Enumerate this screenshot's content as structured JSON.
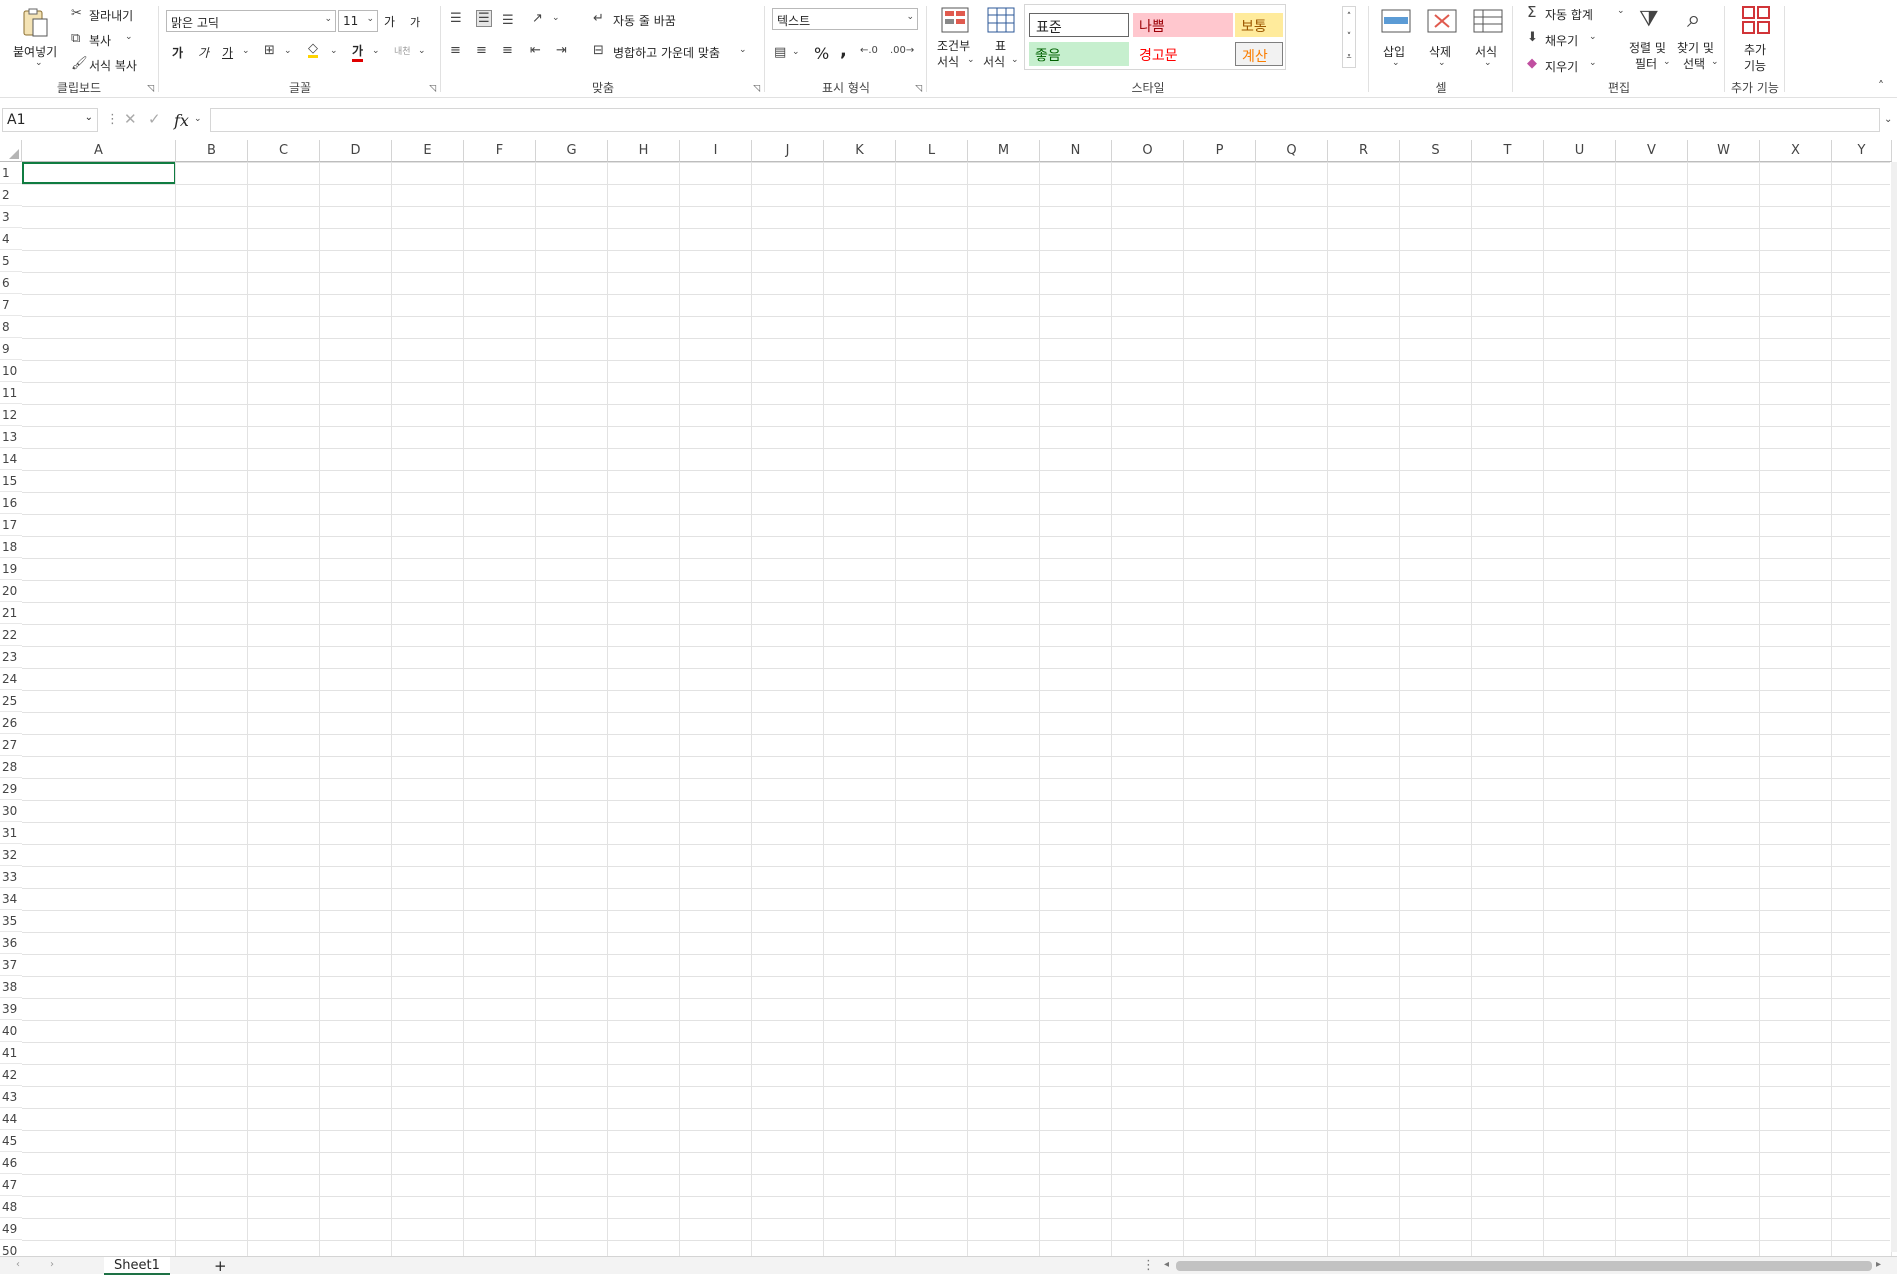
{
  "ribbon": {
    "clipboard": {
      "paste_label": "붙여넣기",
      "cut_label": "잘라내기",
      "copy_label": "복사",
      "format_painter_label": "서식 복사",
      "group_label": "클립보드"
    },
    "font": {
      "font_name": "맑은 고딕",
      "font_size": "11",
      "grow_label": "가",
      "shrink_label": "가",
      "bold_label": "가",
      "italic_label": "가",
      "underline_label": "가",
      "font_color_label": "가",
      "phonetic_label": "내천",
      "group_label": "글꼴"
    },
    "alignment": {
      "wrap_text_label": "자동 줄 바꿈",
      "merge_center_label": "병합하고 가운데 맞춤",
      "group_label": "맞춤"
    },
    "number": {
      "format_value": "텍스트",
      "percent_label": "%",
      "comma_label": ",",
      "group_label": "표시 형식"
    },
    "styles": {
      "conditional_format_label": "조건부",
      "conditional_format_label2": "서식",
      "table_format_label": "표",
      "table_format_label2": "서식",
      "cells": [
        {
          "label": "표준",
          "bg": "#ffffff",
          "fg": "#000000"
        },
        {
          "label": "나쁨",
          "bg": "#ffc7ce",
          "fg": "#9c0006"
        },
        {
          "label": "보통",
          "bg": "#ffeb9c",
          "fg": "#9c5700"
        },
        {
          "label": "좋음",
          "bg": "#c6efce",
          "fg": "#006100"
        },
        {
          "label": "경고문",
          "bg": "#ffffff",
          "fg": "#ff0000"
        },
        {
          "label": "계산",
          "bg": "#f2f2f2",
          "fg": "#fa7d00"
        }
      ],
      "group_label": "스타일"
    },
    "cells": {
      "insert_label": "삽입",
      "delete_label": "삭제",
      "format_label": "서식",
      "group_label": "셀"
    },
    "editing": {
      "autosum_label": "자동 합계",
      "fill_label": "채우기",
      "clear_label": "지우기",
      "sort_filter_label": "정렬 및",
      "sort_filter_label2": "필터",
      "find_select_label": "찾기 및",
      "find_select_label2": "선택",
      "group_label": "편집"
    },
    "addins": {
      "addins_label": "추가",
      "addins_label2": "기능",
      "group_label": "추가 기능"
    }
  },
  "formula_bar": {
    "name_box": "A1",
    "fx_label": "fx",
    "formula": ""
  },
  "grid": {
    "columns": [
      "A",
      "B",
      "C",
      "D",
      "E",
      "F",
      "G",
      "H",
      "I",
      "J",
      "K",
      "L",
      "M",
      "N",
      "O",
      "P",
      "Q",
      "R",
      "S",
      "T",
      "U",
      "V",
      "W",
      "X",
      "Y"
    ],
    "rows": [
      "1",
      "2",
      "3",
      "4",
      "5",
      "6",
      "7",
      "8",
      "9",
      "10",
      "11",
      "12",
      "13",
      "14",
      "15",
      "16",
      "17",
      "18",
      "19",
      "20",
      "21",
      "22",
      "23",
      "24",
      "25",
      "26",
      "27",
      "28",
      "29",
      "30",
      "31",
      "32",
      "33",
      "34",
      "35",
      "36",
      "37",
      "38",
      "39",
      "40",
      "41",
      "42",
      "43",
      "44",
      "45",
      "46",
      "47",
      "48",
      "49",
      "50"
    ]
  },
  "sheets": {
    "tabs": [
      "Sheet1"
    ],
    "add_label": "+"
  }
}
